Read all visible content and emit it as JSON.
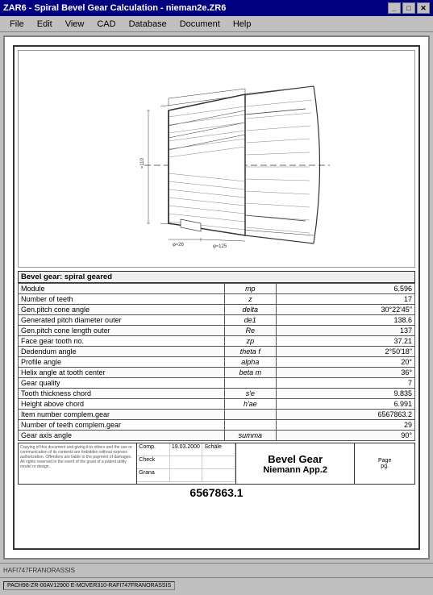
{
  "window": {
    "title": "ZAR6 - Spiral Bevel Gear Calculation  -  nieman2e.ZR6",
    "minimize_label": "_",
    "maximize_label": "□",
    "close_label": "✕"
  },
  "menu": {
    "items": [
      "File",
      "Edit",
      "View",
      "CAD",
      "Database",
      "Document",
      "Help"
    ]
  },
  "drawing": {
    "description": "Spiral bevel gear technical drawing"
  },
  "table": {
    "header": "Bevel gear:  spiral geared",
    "rows": [
      {
        "label": "Module",
        "sym": "mp",
        "val": "6.596"
      },
      {
        "label": "Number of teeth",
        "sym": "z",
        "val": "17"
      },
      {
        "label": "Gen.pitch cone angle",
        "sym": "delta",
        "val": "30°22'45\""
      },
      {
        "label": "Generated pitch diameter outer",
        "sym": "de1",
        "val": "138.6"
      },
      {
        "label": "Gen.pitch cone length outer",
        "sym": "Re",
        "val": "137"
      },
      {
        "label": "Face gear tooth no.",
        "sym": "zp",
        "val": "37.21"
      },
      {
        "label": "Dedendum angle",
        "sym": "theta f",
        "val": "2°50'18\""
      },
      {
        "label": "Profile angle",
        "sym": "alpha",
        "val": "20°"
      },
      {
        "label": "Helix angle at tooth center",
        "sym": "beta m",
        "val": "36°"
      },
      {
        "label": "Gear quality",
        "sym": "",
        "val": "7"
      },
      {
        "label": "Tooth thickness chord",
        "sym": "s'e",
        "val": "9.835"
      },
      {
        "label": "Height above chord",
        "sym": "h'ae",
        "val": "6.991"
      },
      {
        "label": "Item number complem.gear",
        "sym": "",
        "val": "6567863.2"
      },
      {
        "label": "Number of teeth complem.gear",
        "sym": "",
        "val": "29"
      },
      {
        "label": "Gear axis angle",
        "sym": "summa",
        "val": "90°"
      }
    ]
  },
  "title_block": {
    "left_text": "Copying of this document and giving it to others and the use or communication of its contents are forbidden without express authorization. Offenders are liable to the payment of damages. All rights reserved in the event of the grant of a patent utility model or design.",
    "meta": {
      "comp_label": "Comp.",
      "comp_date": "19.03.2000",
      "comp_name": "Schäle",
      "check_label": "Check",
      "grana_label": "Grana"
    },
    "title_line1": "Bevel Gear",
    "title_line2": "Niemann App.2",
    "drawing_number": "6567863.1",
    "page_label": "Page",
    "pg_label": "pg."
  },
  "status_bar": {
    "left": "PACH98-ZR-00AV12900 E-MOVER310-RAFI747FRANORASSIS",
    "right": "E-MOVER310-RAFI747FRANORASSIS"
  },
  "filename_bar": {
    "text": "HAFI747FRANORASSIS"
  }
}
